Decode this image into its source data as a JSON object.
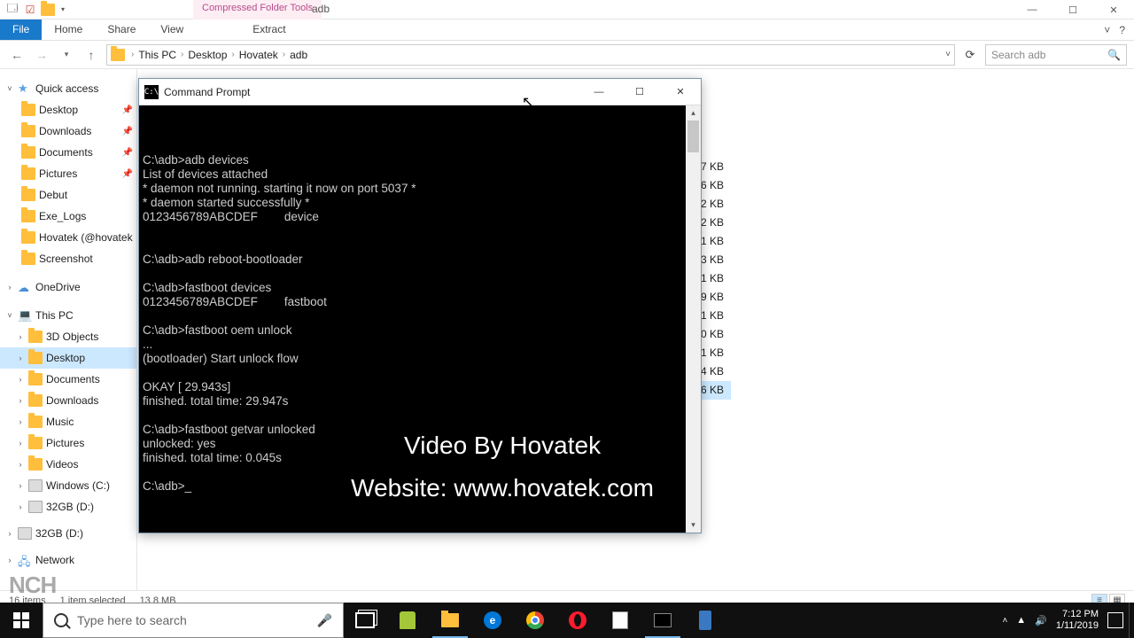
{
  "titlebar": {
    "context_tab": "Compressed Folder Tools",
    "window_title": "adb",
    "minimize": "—",
    "maximize": "☐",
    "close": "✕"
  },
  "ribbon": {
    "file": "File",
    "tabs": [
      "Home",
      "Share",
      "View"
    ],
    "extract": "Extract",
    "help": "?"
  },
  "address": {
    "segments": [
      "This PC",
      "Desktop",
      "Hovatek",
      "adb"
    ],
    "refresh": "⟳",
    "search_placeholder": "Search adb"
  },
  "nav": {
    "quick_access": "Quick access",
    "qa_items": [
      "Desktop",
      "Downloads",
      "Documents",
      "Pictures",
      "Debut",
      "Exe_Logs",
      "Hovatek (@hovatek",
      "Screenshot"
    ],
    "onedrive": "OneDrive",
    "this_pc": "This PC",
    "pc_items": [
      "3D Objects",
      "Desktop",
      "Documents",
      "Downloads",
      "Music",
      "Pictures",
      "Videos",
      "Windows (C:)",
      "32GB (D:)"
    ],
    "extra_drive": "32GB (D:)",
    "network": "Network"
  },
  "filesizes": [
    "7 KB",
    "6 KB",
    "2 KB",
    "2 KB",
    "1 KB",
    "3 KB",
    "1 KB",
    "9 KB",
    "1 KB",
    "0 KB",
    "1 KB",
    "4 KB",
    "6 KB"
  ],
  "filesizes_selected_index": 12,
  "status": {
    "items": "16 items",
    "selected": "1 item selected",
    "size": "13.8 MB"
  },
  "cmd": {
    "title": "Command Prompt",
    "minimize": "—",
    "maximize": "☐",
    "close": "✕",
    "lines": [
      "",
      "C:\\adb>adb devices",
      "List of devices attached",
      "* daemon not running. starting it now on port 5037 *",
      "* daemon started successfully *",
      "0123456789ABCDEF        device",
      "",
      "",
      "C:\\adb>adb reboot-bootloader",
      "",
      "C:\\adb>fastboot devices",
      "0123456789ABCDEF        fastboot",
      "",
      "C:\\adb>fastboot oem unlock",
      "...",
      "(bootloader) Start unlock flow",
      "",
      "OKAY [ 29.943s]",
      "finished. total time: 29.947s",
      "",
      "C:\\adb>fastboot getvar unlocked",
      "unlocked: yes",
      "finished. total time: 0.045s",
      "",
      "C:\\adb>_"
    ],
    "watermark1": "Video By Hovatek",
    "watermark2": "Website: www.hovatek.com"
  },
  "taskbar": {
    "search_placeholder": "Type here to search",
    "time": "7:12 PM",
    "date": "1/11/2019"
  },
  "nch": "NCH"
}
